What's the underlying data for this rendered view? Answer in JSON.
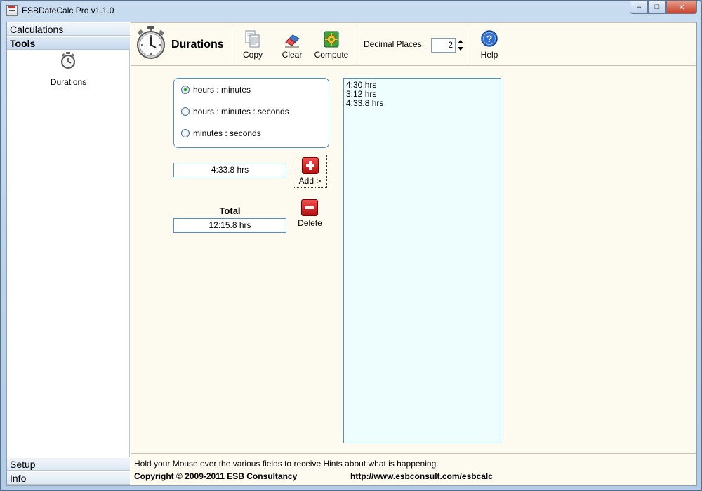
{
  "window": {
    "title": "ESBDateCalc Pro v1.1.0",
    "minimize_glyph": "–",
    "maximize_glyph": "□",
    "close_glyph": "✕"
  },
  "nav": {
    "sections": [
      "Calculations",
      "Tools",
      "Setup",
      "Info"
    ],
    "active_section": "Tools",
    "tools": [
      {
        "label": "Durations",
        "icon": "stopwatch-icon"
      }
    ]
  },
  "toolbar": {
    "title": "Durations",
    "title_icon": "stopwatch-icon",
    "copy_label": "Copy",
    "clear_label": "Clear",
    "compute_label": "Compute",
    "decimal_label": "Decimal Places:",
    "decimal_value": "2",
    "help_label": "Help"
  },
  "format_options": [
    {
      "label": "hours : minutes",
      "checked": true
    },
    {
      "label": "hours : minutes : seconds",
      "checked": false
    },
    {
      "label": "minutes : seconds",
      "checked": false
    }
  ],
  "entry": {
    "value": "4:33.8 hrs"
  },
  "add_label": "Add >",
  "total": {
    "label": "Total",
    "value": "12:15.8 hrs"
  },
  "delete_label": "Delete",
  "results": [
    "4:30 hrs",
    "3:12 hrs",
    "4:33.8 hrs"
  ],
  "status": {
    "hint": "Hold your Mouse over the various fields to receive Hints about what is happening.",
    "copyright": "Copyright © 2009-2011 ESB Consultancy",
    "url": "http://www.esbconsult.com/esbcalc"
  },
  "colors": {
    "accent_border": "#4f90d0",
    "results_bg": "#eefeff",
    "panel_bg": "#fdfaf0",
    "add_delete_red": "#d02020"
  }
}
